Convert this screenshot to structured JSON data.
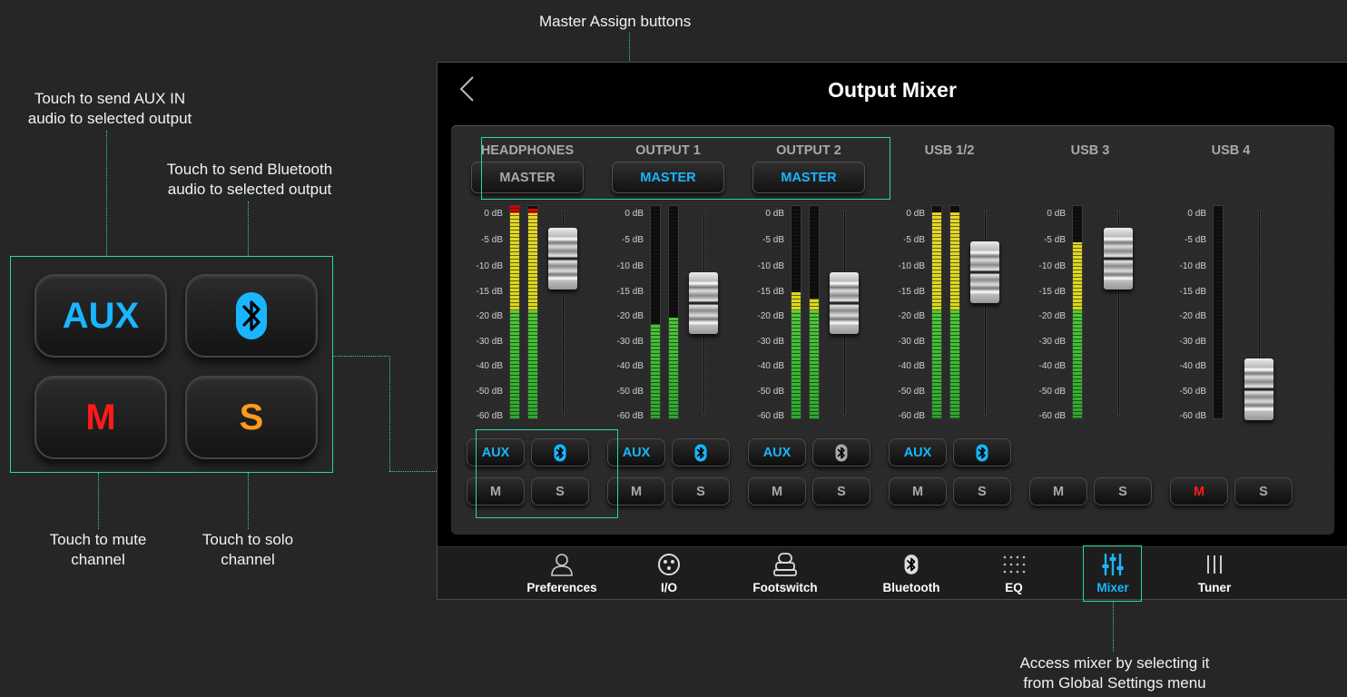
{
  "annotations": {
    "master_assign": "Master Assign buttons",
    "aux_line1": "Touch to send AUX IN",
    "aux_line2": "audio to selected output",
    "bt_line1": "Touch to send Bluetooth",
    "bt_line2": "audio to selected output",
    "mute_line1": "Touch to mute",
    "mute_line2": "channel",
    "solo_line1": "Touch to solo",
    "solo_line2": "channel",
    "access_line1": "Access mixer by selecting it",
    "access_line2": "from Global Settings menu"
  },
  "callout": {
    "aux": "AUX",
    "mute": "M",
    "solo": "S"
  },
  "window": {
    "title": "Output Mixer"
  },
  "scale_labels": [
    "0 dB",
    "-5 dB",
    "-10 dB",
    "-15 dB",
    "-20 dB",
    "-30 dB",
    "-40 dB",
    "-50 dB",
    "-60 dB"
  ],
  "channels": [
    {
      "label": "HEADPHONES",
      "master": "MASTER",
      "master_on": false,
      "aux": "AUX",
      "aux_on": true,
      "bt_on": true,
      "mute": "M",
      "mute_on": false,
      "solo": "S",
      "meter_l": 1.0,
      "meter_r": 0.98,
      "fader": 0.86
    },
    {
      "label": "OUTPUT 1",
      "master": "MASTER",
      "master_on": true,
      "aux": "AUX",
      "aux_on": true,
      "bt_on": true,
      "mute": "M",
      "mute_on": false,
      "solo": "S",
      "meter_l": 0.44,
      "meter_r": 0.47,
      "fader": 0.6
    },
    {
      "label": "OUTPUT 2",
      "master": "MASTER",
      "master_on": true,
      "aux": "AUX",
      "aux_on": true,
      "bt_on": false,
      "mute": "M",
      "mute_on": false,
      "solo": "S",
      "meter_l": 0.59,
      "meter_r": 0.56,
      "fader": 0.6
    },
    {
      "label": "USB 1/2",
      "master": null,
      "aux": "AUX",
      "aux_on": true,
      "bt_on": true,
      "mute": "M",
      "mute_on": false,
      "solo": "S",
      "meter_l": 0.96,
      "meter_r": 0.96,
      "fader": 0.78
    },
    {
      "label": "USB 3",
      "master": null,
      "aux": null,
      "mute": "M",
      "mute_on": false,
      "solo": "S",
      "meter_l": 0.82,
      "meter_r": null,
      "fader": 0.86
    },
    {
      "label": "USB 4",
      "master": null,
      "aux": null,
      "mute": "M",
      "mute_on": true,
      "solo": "S",
      "meter_l": 0.0,
      "meter_r": null,
      "fader": 0.1
    }
  ],
  "nav": [
    {
      "label": "Preferences",
      "icon": "person-icon",
      "active": false
    },
    {
      "label": "I/O",
      "icon": "xlr-connector-icon",
      "active": false
    },
    {
      "label": "Footswitch",
      "icon": "footswitch-icon",
      "active": false
    },
    {
      "label": "Bluetooth",
      "icon": "bluetooth-icon",
      "active": false
    },
    {
      "label": "EQ",
      "icon": "eq-dots-icon",
      "active": false
    },
    {
      "label": "Mixer",
      "icon": "mixer-sliders-icon",
      "active": true
    },
    {
      "label": "Tuner",
      "icon": "tuner-bars-icon",
      "active": false
    }
  ],
  "colors": {
    "accent": "#19b6ff",
    "highlight": "#2bd6a8",
    "mute_red": "#ff1a1a",
    "solo_orange": "#ff9a1a"
  }
}
